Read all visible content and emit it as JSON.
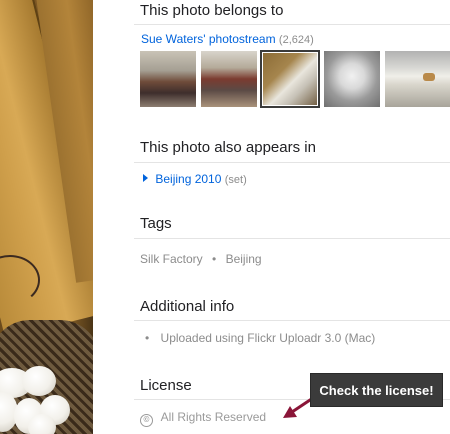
{
  "belongs": {
    "heading": "This photo belongs to",
    "stream_link": "Sue Waters' photostream",
    "stream_count": "(2,624)"
  },
  "thumbnails": [
    {
      "name": "thumbnail-store-interior"
    },
    {
      "name": "thumbnail-clothing-racks"
    },
    {
      "name": "thumbnail-silk-cocoons",
      "selected": true
    },
    {
      "name": "thumbnail-cocoon-closeup"
    },
    {
      "name": "thumbnail-display-case"
    }
  ],
  "appears_in": {
    "heading": "This photo also appears in",
    "set_name": "Beijing 2010",
    "set_type": "(set)"
  },
  "tags": {
    "heading": "Tags",
    "items": [
      "Silk Factory",
      "Beijing"
    ],
    "separator": "•"
  },
  "additional_info": {
    "heading": "Additional info",
    "bullet": "•",
    "upload_text": "Uploaded using Flickr Uploadr 3.0 (Mac)"
  },
  "license": {
    "heading": "License",
    "icon_glyph": "©",
    "text": "All Rights Reserved"
  },
  "callout": {
    "text": "Check the license!"
  },
  "colors": {
    "link": "#0063dc",
    "muted": "#8c8c8c",
    "callout_bg": "#3b3b3b",
    "arrow": "#8a1538"
  }
}
